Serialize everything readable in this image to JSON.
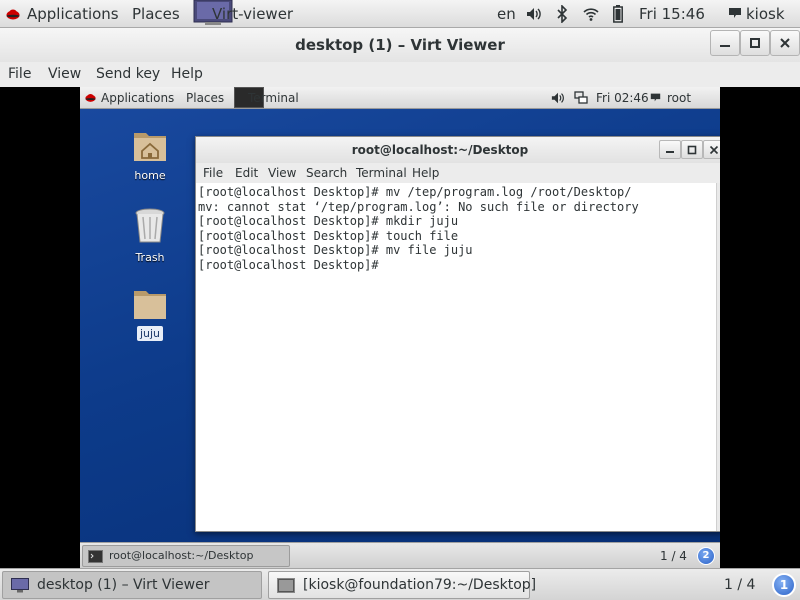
{
  "host_topbar": {
    "applications": "Applications",
    "places": "Places",
    "active_app": "Virt-viewer",
    "language": "en",
    "clock": "Fri 15:46",
    "user": "kiosk",
    "icons": [
      "redhat-icon",
      "virt-viewer-icon",
      "volume-icon",
      "bluetooth-icon",
      "wifi-icon",
      "battery-icon",
      "user-icon"
    ]
  },
  "virt_viewer": {
    "title": "desktop (1) – Virt Viewer",
    "menu": {
      "file": "File",
      "view": "View",
      "send_key": "Send key",
      "help": "Help"
    }
  },
  "guest": {
    "topbar": {
      "applications": "Applications",
      "places": "Places",
      "active_app": "Terminal",
      "clock": "Fri 02:46",
      "user": "root"
    },
    "desktop_icons": {
      "home": "home",
      "trash": "Trash",
      "juju": "juju"
    },
    "terminal": {
      "title": "root@localhost:~/Desktop",
      "menu": {
        "file": "File",
        "edit": "Edit",
        "view": "View",
        "search": "Search",
        "terminal": "Terminal",
        "help": "Help"
      },
      "lines": [
        "[root@localhost Desktop]# mv /tep/program.log /root/Desktop/",
        "mv: cannot stat ‘/tep/program.log’: No such file or directory",
        "[root@localhost Desktop]# mkdir juju",
        "[root@localhost Desktop]# touch file",
        "[root@localhost Desktop]# mv file juju",
        "[root@localhost Desktop]#"
      ]
    },
    "bottombar": {
      "task_terminal": "root@localhost:~/Desktop",
      "workspace": "1 / 4",
      "notifications": "2"
    }
  },
  "host_bottombar": {
    "task_virt_viewer": "desktop (1) – Virt Viewer",
    "task_terminal": "[kiosk@foundation79:~/Desktop]",
    "workspace": "1 / 4",
    "notifications": "1"
  },
  "colors": {
    "guest_desktop": "#0c3a8c",
    "notification_badge": "#2a62c8",
    "redhat": "#cc0000"
  }
}
